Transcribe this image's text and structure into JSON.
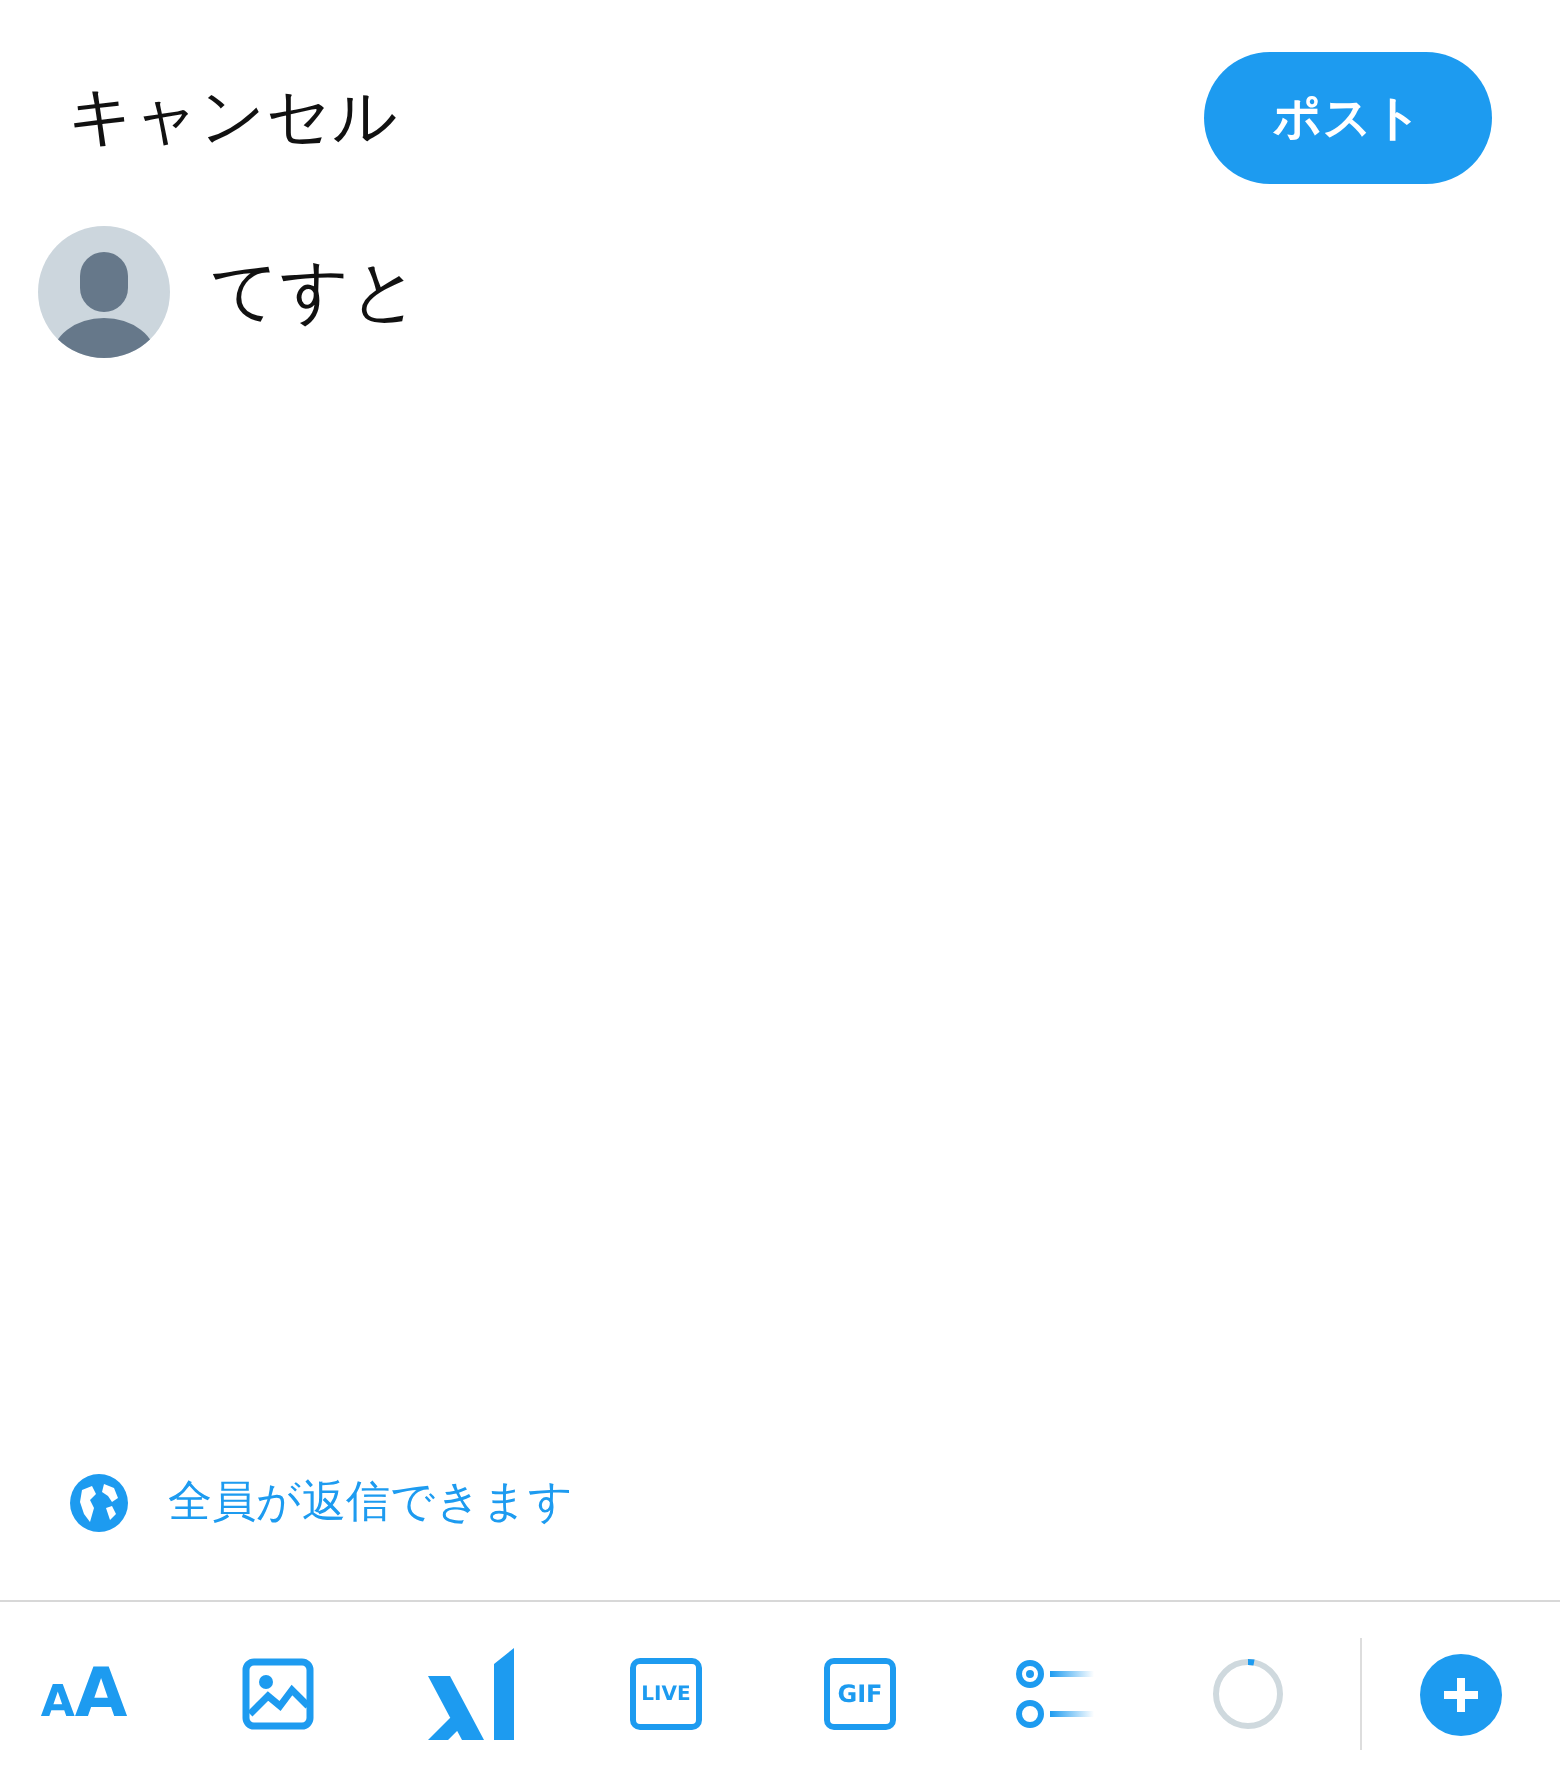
{
  "header": {
    "cancel": "キャンセル",
    "post": "ポスト"
  },
  "compose": {
    "text": "てすと"
  },
  "reply_setting": {
    "label": "全員が返信できます"
  },
  "toolbar": [
    {
      "kind": "text-size",
      "small": "A",
      "large": "A"
    },
    {
      "kind": "image"
    },
    {
      "kind": "strokes"
    },
    {
      "kind": "boxed",
      "label": "LIVE"
    },
    {
      "kind": "boxed",
      "label": "GIF"
    },
    {
      "kind": "poll"
    },
    {
      "kind": "counter",
      "level": 0.03
    },
    {
      "kind": "add"
    }
  ]
}
